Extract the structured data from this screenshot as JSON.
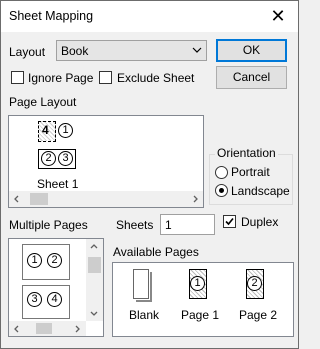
{
  "window": {
    "title": "Sheet Mapping"
  },
  "layout": {
    "label": "Layout",
    "value": "Book"
  },
  "buttons": {
    "ok": "OK",
    "cancel": "Cancel"
  },
  "options": {
    "ignore_page": "Ignore Page",
    "exclude_sheet": "Exclude Sheet"
  },
  "page_layout": {
    "label": "Page Layout",
    "sheet_label": "Sheet 1"
  },
  "orientation": {
    "label": "Orientation",
    "portrait": "Portrait",
    "landscape": "Landscape",
    "selected": "Landscape"
  },
  "multiple_pages": {
    "label": "Multiple Pages",
    "items": [
      [
        "1",
        "2"
      ],
      [
        "3",
        "4"
      ]
    ]
  },
  "sheets": {
    "label": "Sheets",
    "value": "1"
  },
  "duplex": {
    "label": "Duplex",
    "checked": true
  },
  "available_pages": {
    "label": "Available Pages",
    "items": [
      "Blank",
      "Page 1",
      "Page 2"
    ]
  },
  "thumb_numbers": {
    "a": "1",
    "b": "2",
    "c": "3",
    "d": "4"
  }
}
